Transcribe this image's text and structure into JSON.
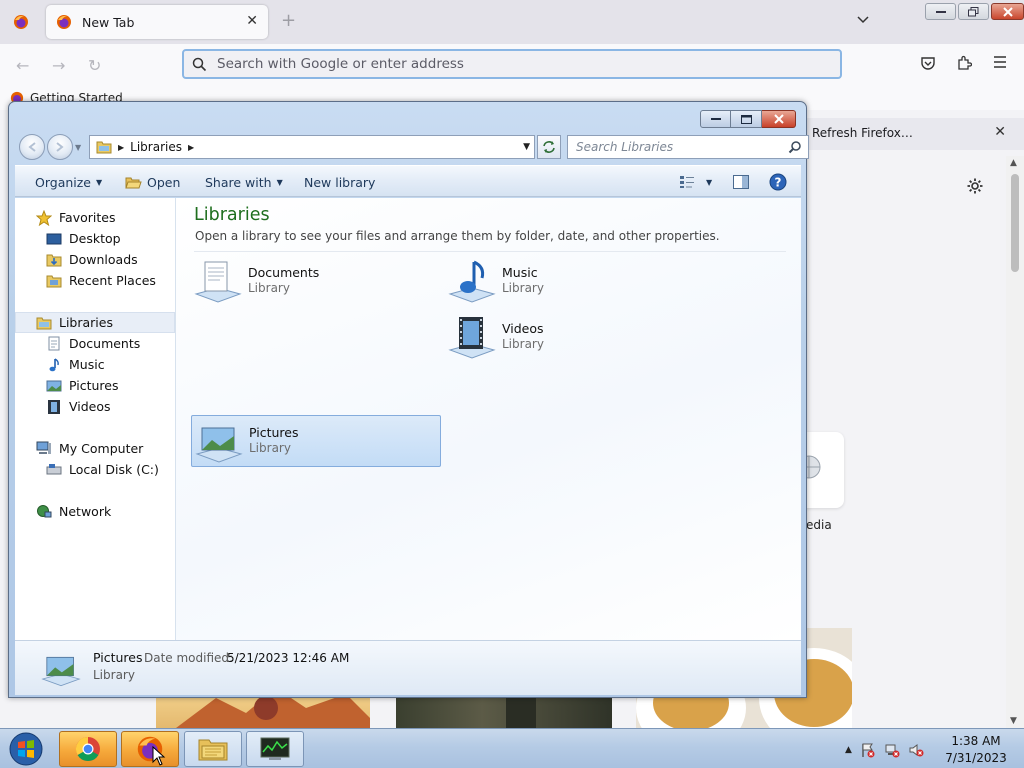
{
  "firefox": {
    "tab_title": "New Tab",
    "url_placeholder": "Search with Google or enter address",
    "bookmark": "Getting Started",
    "notice_button": "Refresh Firefox…",
    "tile_label": "edia"
  },
  "explorer": {
    "breadcrumb": [
      "Libraries"
    ],
    "search_placeholder": "Search Libraries",
    "commands": {
      "organize": "Organize",
      "open": "Open",
      "share_with": "Share with",
      "new_library": "New library"
    },
    "nav": {
      "favorites": "Favorites",
      "desktop": "Desktop",
      "downloads": "Downloads",
      "recent_places": "Recent Places",
      "libraries": "Libraries",
      "documents": "Documents",
      "music": "Music",
      "pictures": "Pictures",
      "videos": "Videos",
      "my_computer": "My Computer",
      "local_disk": "Local Disk (C:)",
      "network": "Network"
    },
    "main": {
      "title": "Libraries",
      "subtitle": "Open a library to see your files and arrange them by folder, date, and other properties.",
      "items": [
        {
          "name": "Documents",
          "type": "Library"
        },
        {
          "name": "Music",
          "type": "Library"
        },
        {
          "name": "Pictures",
          "type": "Library"
        },
        {
          "name": "Videos",
          "type": "Library"
        }
      ]
    },
    "details": {
      "name": "Pictures",
      "date_label": "Date modified:",
      "date_value": "5/21/2023 12:46 AM",
      "type": "Library"
    }
  },
  "taskbar": {
    "time": "1:38 AM",
    "date": "7/31/2023"
  },
  "colors": {
    "library_title": "#1e6e1e",
    "selection_fill": "#c3dcf6",
    "selection_border": "#84acdd",
    "url_focus": "#8ab6e4"
  }
}
